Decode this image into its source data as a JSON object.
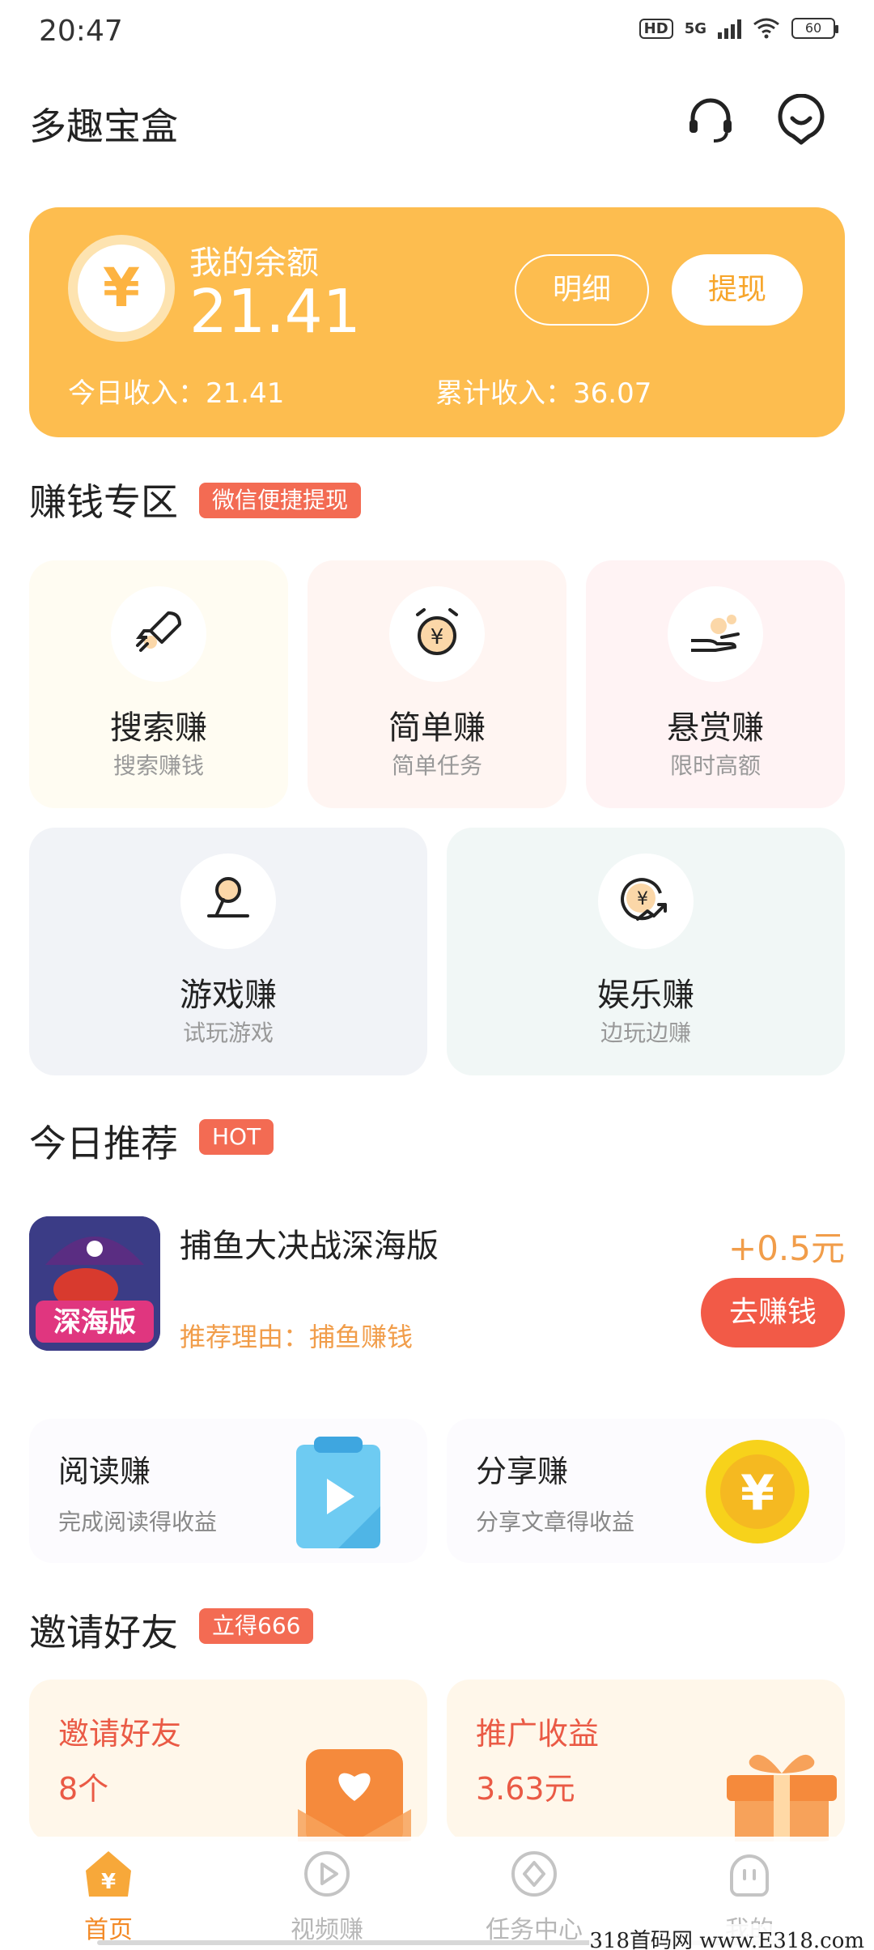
{
  "status": {
    "time": "20:47",
    "hd": "HD",
    "network": "5G",
    "battery": "60"
  },
  "header": {
    "title": "多趣宝盒"
  },
  "balance": {
    "label": "我的余额",
    "value": "21.41",
    "coin_symbol": "¥",
    "detail_button": "明细",
    "withdraw_button": "提现",
    "today_income": "今日收入：21.41",
    "total_income": "累计收入：36.07"
  },
  "earn_section": {
    "title": "赚钱专区",
    "tag": "微信便捷提现",
    "tiles": [
      {
        "name": "搜索赚",
        "sub": "搜索赚钱",
        "icon": "rocket-icon"
      },
      {
        "name": "简单赚",
        "sub": "简单任务",
        "icon": "alarm-coin-icon"
      },
      {
        "name": "悬赏赚",
        "sub": "限时高额",
        "icon": "hand-coins-icon"
      },
      {
        "name": "游戏赚",
        "sub": "试玩游戏",
        "icon": "joystick-icon"
      },
      {
        "name": "娱乐赚",
        "sub": "边玩边赚",
        "icon": "coin-trend-icon"
      }
    ]
  },
  "recommend_section": {
    "title": "今日推荐",
    "tag": "HOT",
    "game": {
      "name": "捕鱼大决战深海版",
      "reason": "推荐理由：捕鱼赚钱",
      "reward": "+0.5元",
      "button": "去赚钱",
      "thumb_text": "深海版"
    }
  },
  "mini_cards": [
    {
      "title": "阅读赚",
      "sub": "完成阅读得收益",
      "icon": "clipboard-play-icon"
    },
    {
      "title": "分享赚",
      "sub": "分享文章得收益",
      "icon": "gold-coin-icon"
    }
  ],
  "invite_section": {
    "title": "邀请好友",
    "tag": "立得666",
    "cards": [
      {
        "title": "邀请好友",
        "value": "8个",
        "icon": "heart-envelope-icon"
      },
      {
        "title": "推广收益",
        "value": "3.63元",
        "icon": "gift-icon"
      }
    ]
  },
  "nav": {
    "items": [
      {
        "label": "首页",
        "icon": "home-coin-icon",
        "active": true
      },
      {
        "label": "视频赚",
        "icon": "play-icon",
        "active": false
      },
      {
        "label": "任务中心",
        "icon": "task-icon",
        "active": false
      },
      {
        "label": "我的",
        "icon": "profile-icon",
        "active": false
      }
    ]
  },
  "watermark": "318首码网 www.E318.com",
  "colors": {
    "accent": "#fdbd4f",
    "tag_red": "#f36b53",
    "button_red": "#f25a47",
    "reward_orange": "#f19d4a",
    "nav_active": "#f38a27"
  }
}
